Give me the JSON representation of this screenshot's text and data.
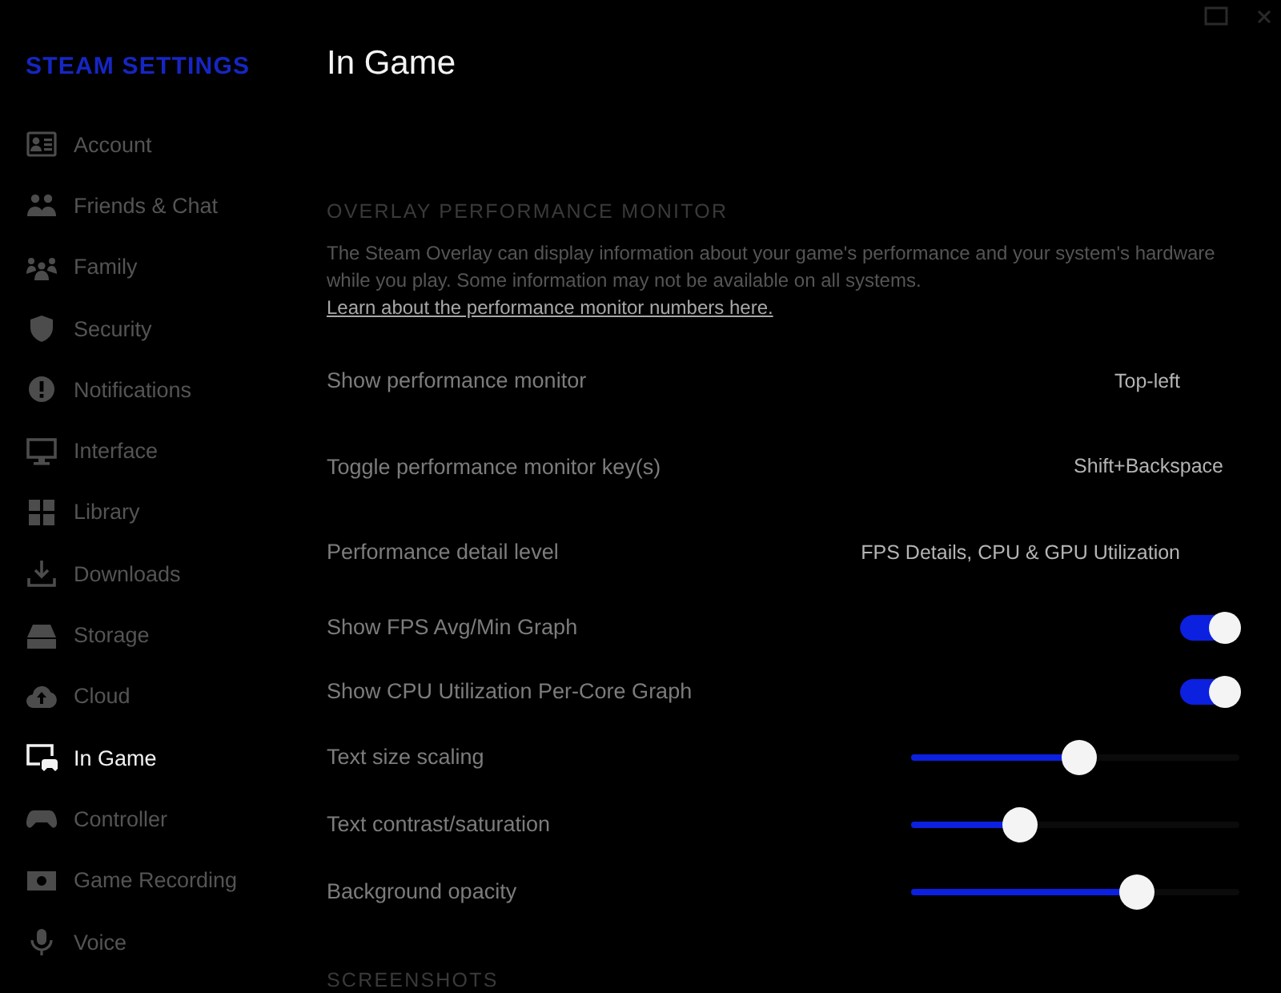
{
  "sidebar": {
    "title": "STEAM SETTINGS",
    "items": [
      {
        "label": "Account",
        "selected": false
      },
      {
        "label": "Friends & Chat",
        "selected": false
      },
      {
        "label": "Family",
        "selected": false
      },
      {
        "label": "Security",
        "selected": false
      },
      {
        "label": "Notifications",
        "selected": false
      },
      {
        "label": "Interface",
        "selected": false
      },
      {
        "label": "Library",
        "selected": false
      },
      {
        "label": "Downloads",
        "selected": false
      },
      {
        "label": "Storage",
        "selected": false
      },
      {
        "label": "Cloud",
        "selected": false
      },
      {
        "label": "In Game",
        "selected": true
      },
      {
        "label": "Controller",
        "selected": false
      },
      {
        "label": "Game Recording",
        "selected": false
      },
      {
        "label": "Voice",
        "selected": false
      }
    ]
  },
  "page": {
    "title": "In Game"
  },
  "sections": [
    {
      "heading": "OVERLAY PERFORMANCE MONITOR",
      "description": "The Steam Overlay can display information about your game's performance and your system's hardware while you play. Some information may not be available on all systems.",
      "link": "Learn about the performance monitor numbers here.",
      "settings": [
        {
          "kind": "dropdown",
          "label": "Show performance monitor",
          "value": "Top-left"
        },
        {
          "kind": "keybind",
          "label": "Toggle performance monitor key(s)",
          "value": "Shift+Backspace"
        },
        {
          "kind": "dropdown",
          "label": "Performance detail level",
          "value": "FPS Details, CPU & GPU Utilization"
        },
        {
          "kind": "toggle",
          "label": "Show FPS Avg/Min Graph",
          "on": true
        },
        {
          "kind": "toggle",
          "label": "Show CPU Utilization Per-Core Graph",
          "on": true
        },
        {
          "kind": "slider",
          "label": "Text size scaling",
          "level": 0.51
        },
        {
          "kind": "slider",
          "label": "Text contrast/saturation",
          "level": 0.33
        },
        {
          "kind": "slider",
          "label": "Background opacity",
          "level": 0.69
        }
      ]
    },
    {
      "heading": "SCREENSHOTS"
    }
  ]
}
